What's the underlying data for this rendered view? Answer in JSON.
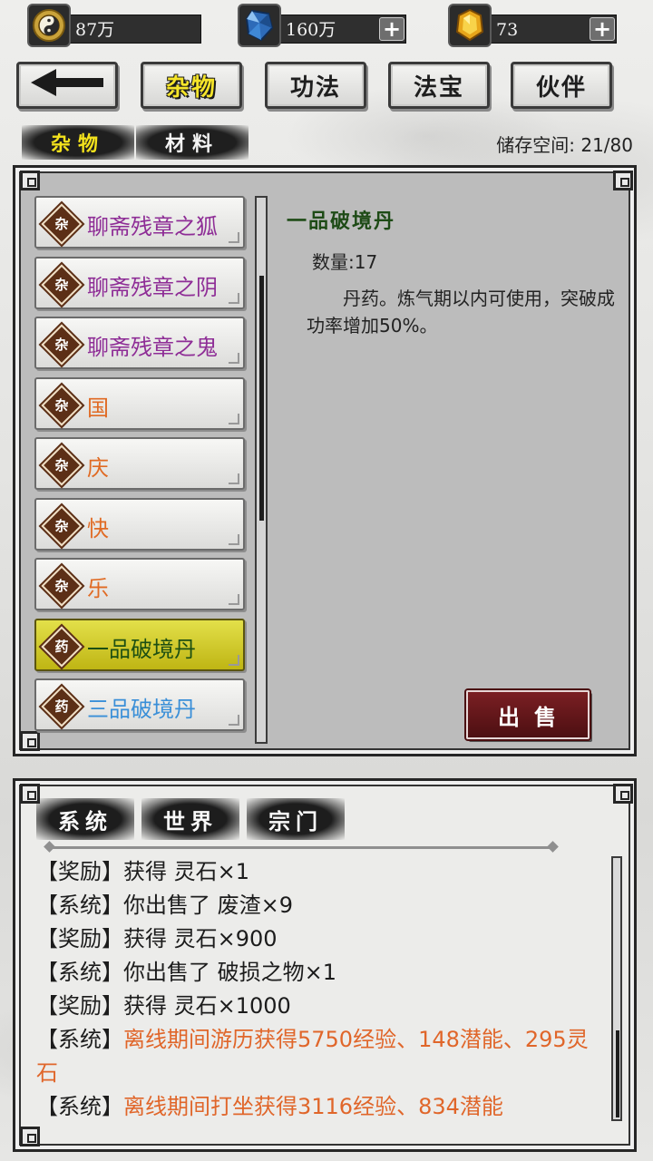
{
  "currencies": [
    {
      "icon": "taiji-coin-icon",
      "value": "87万",
      "has_plus": false
    },
    {
      "icon": "blue-crystal-icon",
      "value": "160万",
      "has_plus": true
    },
    {
      "icon": "gold-gem-icon",
      "value": "73",
      "has_plus": true
    }
  ],
  "plus_glyph": "+",
  "nav": {
    "back_icon": "back-arrow-icon",
    "tabs": [
      {
        "label": "杂物",
        "active": true
      },
      {
        "label": "功法",
        "active": false
      },
      {
        "label": "法宝",
        "active": false
      },
      {
        "label": "伙伴",
        "active": false
      }
    ]
  },
  "subtabs": [
    {
      "label": "杂物",
      "active": true,
      "color": "#f3e21c"
    },
    {
      "label": "材料",
      "active": false,
      "color": "#f4f4f4"
    }
  ],
  "storage": "储存空间: 21/80",
  "items": [
    {
      "badge": "杂",
      "name": "聊斋残章之狐",
      "color": "#8e2d96",
      "selected": false
    },
    {
      "badge": "杂",
      "name": "聊斋残章之阴",
      "color": "#8e2d96",
      "selected": false
    },
    {
      "badge": "杂",
      "name": "聊斋残章之鬼",
      "color": "#8e2d96",
      "selected": false
    },
    {
      "badge": "杂",
      "name": "国",
      "color": "#e06a23",
      "selected": false
    },
    {
      "badge": "杂",
      "name": "庆",
      "color": "#e06a23",
      "selected": false
    },
    {
      "badge": "杂",
      "name": "快",
      "color": "#e06a23",
      "selected": false
    },
    {
      "badge": "杂",
      "name": "乐",
      "color": "#e06a23",
      "selected": false
    },
    {
      "badge": "药",
      "name": "一品破境丹",
      "color": "#1d4f12",
      "selected": true
    },
    {
      "badge": "药",
      "name": "三品破境丹",
      "color": "#3a8fd8",
      "selected": false
    }
  ],
  "detail": {
    "title": "一品破境丹",
    "quantity": "数量:17",
    "description": "丹药。炼气期以内可使用，突破成功率增加50%。",
    "sell_label": "出售"
  },
  "chat": {
    "tabs": [
      "系统",
      "世界",
      "宗门"
    ],
    "messages": [
      {
        "tag": "【奖励】",
        "text": "获得 灵石×1",
        "highlight": false
      },
      {
        "tag": "【系统】",
        "text": "你出售了 废渣×9",
        "highlight": false
      },
      {
        "tag": "【奖励】",
        "text": "获得 灵石×900",
        "highlight": false
      },
      {
        "tag": "【系统】",
        "text": "你出售了 破损之物×1",
        "highlight": false
      },
      {
        "tag": "【奖励】",
        "text": "获得 灵石×1000",
        "highlight": false
      },
      {
        "tag": "【系统】",
        "text": "离线期间游历获得5750经验、148潜能、295灵石",
        "highlight": true
      },
      {
        "tag": "【系统】",
        "text": "离线期间打坐获得3116经验、834潜能",
        "highlight": true
      }
    ]
  }
}
